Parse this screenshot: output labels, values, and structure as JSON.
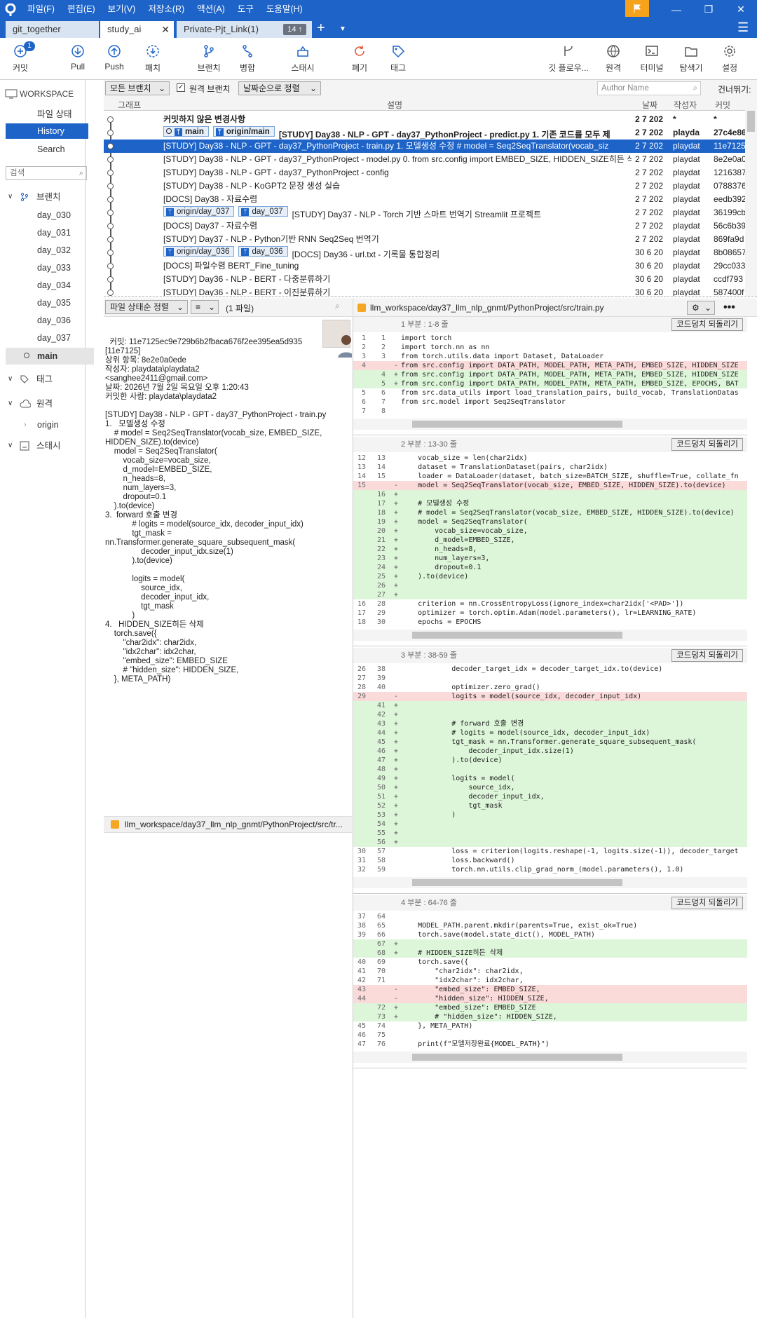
{
  "menu": [
    "파일(F)",
    "편집(E)",
    "보기(V)",
    "저장소(R)",
    "액션(A)",
    "도구",
    "도움말(H)"
  ],
  "tabs": [
    {
      "label": "git_together"
    },
    {
      "label": "study_ai"
    },
    {
      "label": "Private-Pjt_Link(1)",
      "count": "14 ↑"
    }
  ],
  "toolbar": {
    "commit": "커밋",
    "commit_badge": "1",
    "pull": "Pull",
    "push": "Push",
    "fetch": "패치",
    "branch": "브랜치",
    "merge": "병합",
    "stash": "스태시",
    "discard": "폐기",
    "tag": "태그",
    "gitflow": "깃 플로우...",
    "remote": "원격",
    "terminal": "터미널",
    "explorer": "탐색기",
    "settings": "설정"
  },
  "sidebar": {
    "workspace": "WORKSPACE",
    "file_status": "파일 상태",
    "history": "History",
    "search": "Search",
    "search_placeholder": "검색",
    "branches_label": "브랜치",
    "branches": [
      "day_030",
      "day_031",
      "day_032",
      "day_033",
      "day_034",
      "day_035",
      "day_036",
      "day_037",
      "main"
    ],
    "tags_label": "태그",
    "remotes_label": "원격",
    "origin": "origin",
    "stash_label": "스태시"
  },
  "filter": {
    "branches": "모든 브랜치",
    "remote_branches": "원격 브랜치",
    "sort": "날짜순으로 정렬",
    "author_placeholder": "Author Name",
    "jump": "건너뛰기:"
  },
  "columns": {
    "graph": "그래프",
    "desc": "설명",
    "date": "날짜",
    "author": "작성자",
    "commit": "커밋"
  },
  "commits": [
    {
      "desc": "커밋하지 않은 변경사항",
      "date": "2 7 202",
      "author": "*",
      "hash": "*",
      "bold": true
    },
    {
      "tags": [
        "main",
        "origin/main"
      ],
      "desc": "[STUDY] Day38 - NLP - GPT - day37_PythonProject - predict.py 1. 기존 코드를 모두 제",
      "date": "2 7 202",
      "author": "playda",
      "hash": "27c4e86",
      "bold": true
    },
    {
      "desc": "[STUDY] Day38 - NLP - GPT - day37_PythonProject - train.py 1.  모델생성 수정    # model = Seq2SeqTranslator(vocab_siz",
      "date": "2 7 202",
      "author": "playdat",
      "hash": "11e7125",
      "sel": true
    },
    {
      "desc": "[STUDY] Day38 - NLP - GPT - day37_PythonProject - model.py 0. from src.config import EMBED_SIZE, HIDDEN_SIZE히든 삭",
      "date": "2 7 202",
      "author": "playdat",
      "hash": "8e2e0a0"
    },
    {
      "desc": "[STUDY] Day38 - NLP - GPT - day37_PythonProject - config",
      "date": "2 7 202",
      "author": "playdat",
      "hash": "1216387"
    },
    {
      "desc": "[STUDY] Day38 - NLP - KoGPT2 문장 생성 실습",
      "date": "2 7 202",
      "author": "playdat",
      "hash": "0788376"
    },
    {
      "desc": "[DOCS] Day38 - 자료수렴",
      "date": "2 7 202",
      "author": "playdat",
      "hash": "eedb392"
    },
    {
      "tags": [
        "origin/day_037",
        "day_037"
      ],
      "desc": "[STUDY] Day37 - NLP - Torch 기반 스마트 번역기 Streamlit 프로젝트",
      "date": "2 7 202",
      "author": "playdat",
      "hash": "36199cb"
    },
    {
      "desc": "[DOCS] Day37 - 자료수렴",
      "date": "2 7 202",
      "author": "playdat",
      "hash": "56c6b39"
    },
    {
      "desc": "[STUDY] Day37 - NLP - Python기반 RNN Seq2Seq 번역기",
      "date": "2 7 202",
      "author": "playdat",
      "hash": "869fa9d"
    },
    {
      "tags": [
        "origin/day_036",
        "day_036"
      ],
      "desc": "[DOCS] Day36 - url.txt - 기록물 통합정리",
      "date": "30 6 20",
      "author": "playdat",
      "hash": "8b08657"
    },
    {
      "desc": "[DOCS] 파일수렴 BERT_Fine_tuning",
      "date": "30 6 20",
      "author": "playdat",
      "hash": "29cc033"
    },
    {
      "desc": "[STUDY] Day36 - NLP - BERT - 다중분류하기",
      "date": "30 6 20",
      "author": "playdat",
      "hash": "ccdf793"
    },
    {
      "desc": "[STUDY] Day36 - NLP - BERT - 이진분류하기",
      "date": "30 6 20",
      "author": "playdat",
      "hash": "587400f"
    }
  ],
  "bottom": {
    "sort": "파일 상태순 정렬",
    "view": "≡",
    "count": "(1 파일)",
    "file": "llm_workspace/day37_llm_nlp_gnmt/PythonProject/src/tr..."
  },
  "details": "커밋: 11e7125ec9e729b6b2fbaca676f2ee395ea5d935\n[11e7125]\n상위 항목: 8e2e0a0ede\n작성자: playdata\\playdata2\n<sanghee2411@gmail.com>\n날짜: 2026년 7월 2일 목요일 오후 1:20:43\n커밋한 사람: playdata\\playdata2\n\n[STUDY] Day38 - NLP - GPT - day37_PythonProject - train.py\n1.   모델생성 수정\n    # model = Seq2SeqTranslator(vocab_size, EMBED_SIZE,\nHIDDEN_SIZE).to(device)\n    model = Seq2SeqTranslator(\n        vocab_size=vocab_size,\n        d_model=EMBED_SIZE,\n        n_heads=8,\n        num_layers=3,\n        dropout=0.1\n    ).to(device)\n3.  forward 호출 변경\n            # logits = model(source_idx, decoder_input_idx)\n            tgt_mask =\nnn.Transformer.generate_square_subsequent_mask(\n                decoder_input_idx.size(1)\n            ).to(device)\n\n            logits = model(\n                source_idx,\n                decoder_input_idx,\n                tgt_mask\n            )\n4.   HIDDEN_SIZE히든 삭제\n    torch.save({\n        \"char2idx\": char2idx,\n        \"idx2char\": idx2char,\n        \"embed_size\": EMBED_SIZE\n        # \"hidden_size\": HIDDEN_SIZE,\n    }, META_PATH)",
  "diff": {
    "path": "llm_workspace/day37_llm_nlp_gnmt/PythonProject/src/train.py",
    "revert": "코드덩치 되돌리기",
    "hunks": [
      {
        "title": "1 부분 : 1-8 줄",
        "lines": [
          [
            "1",
            "1",
            "",
            "import torch"
          ],
          [
            "2",
            "2",
            "",
            "import torch.nn as nn"
          ],
          [
            "3",
            "3",
            "",
            "from torch.utils.data import Dataset, DataLoader"
          ],
          [
            "4",
            "",
            "-",
            "from src.config import DATA_PATH, MODEL_PATH, META_PATH, EMBED_SIZE, HIDDEN_SIZE"
          ],
          [
            "",
            "4",
            "+",
            "from src.config import DATA_PATH, MODEL_PATH, META_PATH, EMBED_SIZE, HIDDEN_SIZE"
          ],
          [
            "",
            "5",
            "+",
            "from src.config import DATA_PATH, MODEL_PATH, META_PATH, EMBED_SIZE, EPOCHS, BAT"
          ],
          [
            "5",
            "6",
            "",
            "from src.data_utils import load_translation_pairs, build_vocab, TranslationDatas"
          ],
          [
            "6",
            "7",
            "",
            "from src.model import Seq2SeqTranslator"
          ],
          [
            "7",
            "8",
            "",
            ""
          ]
        ]
      },
      {
        "title": "2 부분 : 13-30 줄",
        "lines": [
          [
            "12",
            "13",
            "",
            "    vocab_size = len(char2idx)"
          ],
          [
            "13",
            "14",
            "",
            "    dataset = TranslationDataset(pairs, char2idx)"
          ],
          [
            "14",
            "15",
            "",
            "    loader = DataLoader(dataset, batch_size=BATCH_SIZE, shuffle=True, collate_fn"
          ],
          [
            "15",
            "",
            "-",
            "    model = Seq2SeqTranslator(vocab_size, EMBED_SIZE, HIDDEN_SIZE).to(device)"
          ],
          [
            "",
            "16",
            "+",
            ""
          ],
          [
            "",
            "17",
            "+",
            "    # 모델생성 수정"
          ],
          [
            "",
            "18",
            "+",
            "    # model = Seq2SeqTranslator(vocab_size, EMBED_SIZE, HIDDEN_SIZE).to(device)"
          ],
          [
            "",
            "19",
            "+",
            "    model = Seq2SeqTranslator("
          ],
          [
            "",
            "20",
            "+",
            "        vocab_size=vocab_size,"
          ],
          [
            "",
            "21",
            "+",
            "        d_model=EMBED_SIZE,"
          ],
          [
            "",
            "22",
            "+",
            "        n_heads=8,"
          ],
          [
            "",
            "23",
            "+",
            "        num_layers=3,"
          ],
          [
            "",
            "24",
            "+",
            "        dropout=0.1"
          ],
          [
            "",
            "25",
            "+",
            "    ).to(device)"
          ],
          [
            "",
            "26",
            "+",
            ""
          ],
          [
            "",
            "27",
            "+",
            ""
          ],
          [
            "16",
            "28",
            "",
            "    criterion = nn.CrossEntropyLoss(ignore_index=char2idx['<PAD>'])"
          ],
          [
            "17",
            "29",
            "",
            "    optimizer = torch.optim.Adam(model.parameters(), lr=LEARNING_RATE)"
          ],
          [
            "18",
            "30",
            "",
            "    epochs = EPOCHS"
          ]
        ]
      },
      {
        "title": "3 부분 : 38-59 줄",
        "lines": [
          [
            "26",
            "38",
            "",
            "            decoder_target_idx = decoder_target_idx.to(device)"
          ],
          [
            "27",
            "39",
            "",
            ""
          ],
          [
            "28",
            "40",
            "",
            "            optimizer.zero_grad()"
          ],
          [
            "29",
            "",
            "-",
            "            logits = model(source_idx, decoder_input_idx)"
          ],
          [
            "",
            "41",
            "+",
            ""
          ],
          [
            "",
            "42",
            "+",
            ""
          ],
          [
            "",
            "43",
            "+",
            "            # forward 호출 변경"
          ],
          [
            "",
            "44",
            "+",
            "            # logits = model(source_idx, decoder_input_idx)"
          ],
          [
            "",
            "45",
            "+",
            "            tgt_mask = nn.Transformer.generate_square_subsequent_mask("
          ],
          [
            "",
            "46",
            "+",
            "                decoder_input_idx.size(1)"
          ],
          [
            "",
            "47",
            "+",
            "            ).to(device)"
          ],
          [
            "",
            "48",
            "+",
            ""
          ],
          [
            "",
            "49",
            "+",
            "            logits = model("
          ],
          [
            "",
            "50",
            "+",
            "                source_idx,"
          ],
          [
            "",
            "51",
            "+",
            "                decoder_input_idx,"
          ],
          [
            "",
            "52",
            "+",
            "                tgt_mask"
          ],
          [
            "",
            "53",
            "+",
            "            )"
          ],
          [
            "",
            "54",
            "+",
            ""
          ],
          [
            "",
            "55",
            "+",
            ""
          ],
          [
            "",
            "56",
            "+",
            ""
          ],
          [
            "30",
            "57",
            "",
            "            loss = criterion(logits.reshape(-1, logits.size(-1)), decoder_target"
          ],
          [
            "31",
            "58",
            "",
            "            loss.backward()"
          ],
          [
            "32",
            "59",
            "",
            "            torch.nn.utils.clip_grad_norm_(model.parameters(), 1.0)"
          ]
        ]
      },
      {
        "title": "4 부분 : 64-76 줄",
        "lines": [
          [
            "37",
            "64",
            "",
            ""
          ],
          [
            "38",
            "65",
            "",
            "    MODEL_PATH.parent.mkdir(parents=True, exist_ok=True)"
          ],
          [
            "39",
            "66",
            "",
            "    torch.save(model.state_dict(), MODEL_PATH)"
          ],
          [
            "",
            "67",
            "+",
            ""
          ],
          [
            "",
            "68",
            "+",
            "    # HIDDEN_SIZE히든 삭제"
          ],
          [
            "40",
            "69",
            "",
            "    torch.save({"
          ],
          [
            "41",
            "70",
            "",
            "        \"char2idx\": char2idx,"
          ],
          [
            "42",
            "71",
            "",
            "        \"idx2char\": idx2char,"
          ],
          [
            "43",
            "",
            "-",
            "        \"embed_size\": EMBED_SIZE,"
          ],
          [
            "44",
            "",
            "-",
            "        \"hidden_size\": HIDDEN_SIZE,"
          ],
          [
            "",
            "72",
            "+",
            "        \"embed_size\": EMBED_SIZE"
          ],
          [
            "",
            "73",
            "+",
            "        # \"hidden_size\": HIDDEN_SIZE,"
          ],
          [
            "45",
            "74",
            "",
            "    }, META_PATH)"
          ],
          [
            "46",
            "75",
            "",
            ""
          ],
          [
            "47",
            "76",
            "",
            "    print(f\"모델저장완료{MODEL_PATH}\")"
          ]
        ]
      }
    ]
  }
}
